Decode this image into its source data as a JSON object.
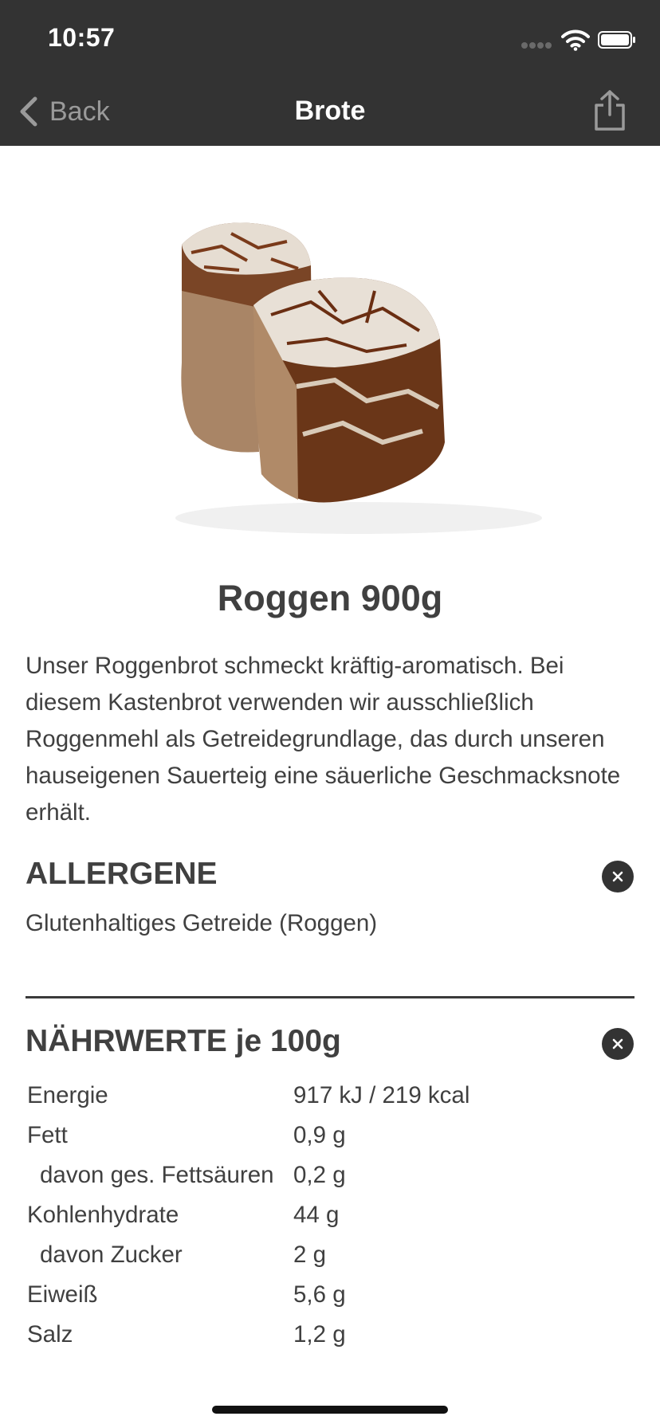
{
  "status_bar": {
    "time": "10:57"
  },
  "nav": {
    "back_label": "Back",
    "title": "Brote"
  },
  "product": {
    "name": "Roggen 900g",
    "description": "Unser Roggenbrot schmeckt kräftig-aromatisch. Bei diesem Kastenbrot verwenden wir ausschließlich Roggenmehl als Getreidegrundlage, das durch unseren hauseigenen Sauerteig eine säuerliche Geschmacksnote erhält."
  },
  "allergens": {
    "heading": "ALLERGENE",
    "text": "Glutenhaltiges Getreide (Roggen)"
  },
  "nutrition": {
    "heading": "NÄHRWERTE je 100g",
    "rows": [
      {
        "label": "Energie",
        "value": "917 kJ / 219 kcal"
      },
      {
        "label": "Fett",
        "value": "0,9 g"
      },
      {
        "label": "davon ges. Fettsäuren",
        "value": "0,2 g"
      },
      {
        "label": "Kohlenhydrate",
        "value": "44 g"
      },
      {
        "label": "davon Zucker",
        "value": "2 g"
      },
      {
        "label": "Eiweiß",
        "value": "5,6 g"
      },
      {
        "label": "Salz",
        "value": "1,2 g"
      }
    ]
  },
  "icons": {
    "back": "chevron-left-icon",
    "share": "share-icon",
    "close": "close-icon",
    "wifi": "wifi-icon",
    "battery": "battery-icon"
  },
  "colors": {
    "header_bg": "#333333",
    "text": "#404040",
    "muted": "#9a9a9a"
  }
}
